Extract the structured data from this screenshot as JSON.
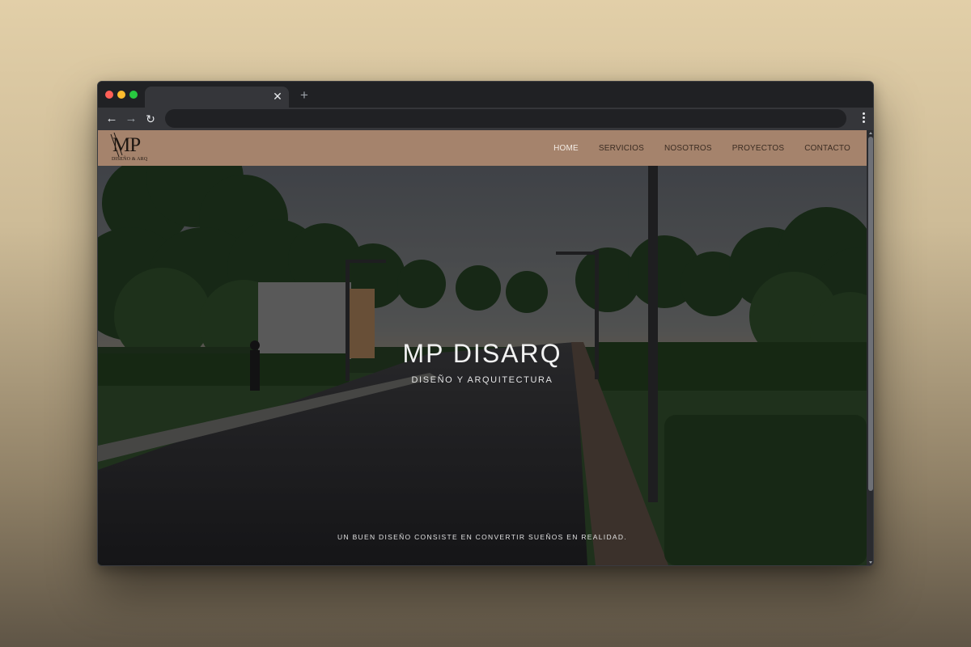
{
  "browser": {
    "tab_title": "",
    "tab_close_glyph": "✕",
    "new_tab_glyph": "+",
    "url": "",
    "back_glyph": "←",
    "forward_glyph": "→",
    "reload_glyph": "↻",
    "traffic_lights": {
      "close": "#ff5f57",
      "minimize": "#febc2e",
      "zoom": "#28c840"
    }
  },
  "site": {
    "logo": {
      "mark": "MP",
      "tagline": "DISEÑO & ARQ"
    },
    "nav": [
      {
        "label": "HOME",
        "active": true
      },
      {
        "label": "SERVICIOS",
        "active": false
      },
      {
        "label": "NOSOTROS",
        "active": false
      },
      {
        "label": "PROYECTOS",
        "active": false
      },
      {
        "label": "CONTACTO",
        "active": false
      }
    ],
    "hero": {
      "title": "MP DISARQ",
      "subtitle": "DISEÑO Y ARQUITECTURA",
      "quote": "UN BUEN DISEÑO CONSISTE EN CONVERTIR SUEÑOS EN REALIDAD."
    },
    "colors": {
      "header_bg": "#a5836c",
      "nav_text": "#3b2c22",
      "nav_active": "#f3ece4"
    }
  }
}
